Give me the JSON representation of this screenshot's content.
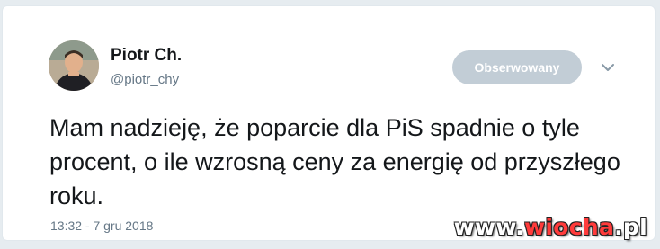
{
  "tweet": {
    "author_name": "Piotr Ch.",
    "author_handle": "@piotr_chy",
    "follow_button_label": "Obserwowany",
    "text": "Mam nadzieję, że poparcie dla PiS spadnie o tyle procent, o ile wzrosną ceny za energię od przyszłego roku.",
    "timestamp": "13:32 - 7 gru 2018"
  },
  "icons": {
    "menu": "chevron-down-icon",
    "avatar": "avatar"
  },
  "watermark": {
    "prefix": "www.",
    "brand": "wiocha",
    "suffix": ".pl"
  },
  "colors": {
    "text": "#14171a",
    "secondary": "#657786",
    "button_bg": "#c2cdd6",
    "background": "#e6ecf0"
  }
}
